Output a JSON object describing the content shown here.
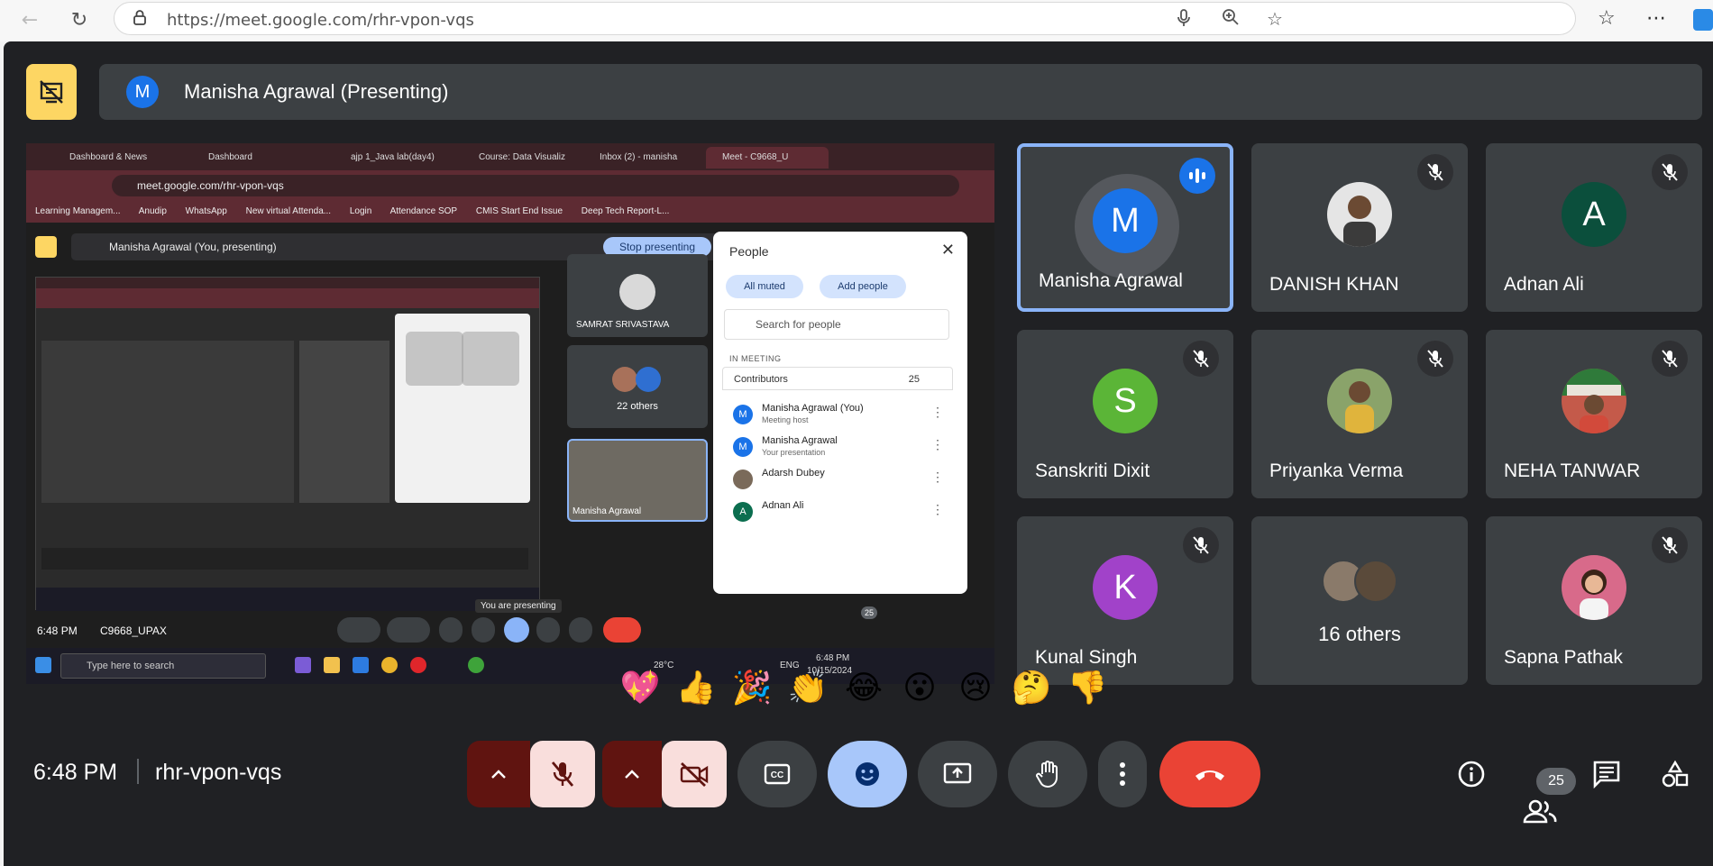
{
  "browser": {
    "url": "https://meet.google.com/rhr-vpon-vqs"
  },
  "meet": {
    "presenting_banner": "Manisha Agrawal (Presenting)",
    "presenter_initial": "M",
    "meeting_time": "6:48 PM",
    "meeting_code": "rhr-vpon-vqs",
    "participant_count": "25"
  },
  "shared_screen": {
    "tabs": [
      "Dashboard & News",
      "Dashboard",
      "ajp 1_Java lab(day4)",
      "Course: Data Visualiz",
      "Inbox (2) - manisha",
      "Meet - C9668_U"
    ],
    "url": "meet.google.com/rhr-vpon-vqs",
    "bookmarks": [
      "Learning Managem...",
      "Anudip",
      "WhatsApp",
      "New virtual Attenda...",
      "Login",
      "Attendance SOP",
      "CMIS Start End Issue",
      "Deep Tech Report-L..."
    ],
    "banner": "Manisha Agrawal (You, presenting)",
    "stop_button": "Stop presenting",
    "tile_samrat": "SAMRAT SRIVASTAVA",
    "tile_others": "22 others",
    "tile_manisha": "Manisha Agrawal",
    "you_are_presenting": "You are presenting",
    "time_code": "6:48 PM",
    "meeting_name": "C9668_UPAX",
    "count_badge": "25",
    "people": {
      "title": "People",
      "all_muted": "All muted",
      "add_people": "Add people",
      "search_placeholder": "Search for people",
      "in_meeting": "IN MEETING",
      "contributors": "Contributors",
      "contributors_count": "25",
      "rows": [
        {
          "initial": "M",
          "name": "Manisha Agrawal (You)",
          "sub": "Meeting host"
        },
        {
          "initial": "M",
          "name": "Manisha Agrawal",
          "sub": "Your presentation"
        },
        {
          "initial": "",
          "name": "Adarsh Dubey",
          "sub": ""
        },
        {
          "initial": "A",
          "name": "Adnan Ali",
          "sub": ""
        }
      ]
    },
    "taskbar": {
      "search": "Type here to search",
      "temp": "28°C",
      "lang": "ENG",
      "time": "6:48 PM",
      "date": "10/15/2024"
    }
  },
  "participants": [
    {
      "name": "Manisha Agrawal",
      "initial": "M",
      "color": "#1a73e8"
    },
    {
      "name": "DANISH KHAN",
      "initial": "",
      "color": "#d9d9d9"
    },
    {
      "name": "Adnan Ali",
      "initial": "A",
      "color": "#0b6e4f"
    },
    {
      "name": "Sanskriti Dixit",
      "initial": "S",
      "color": "#5bb537"
    },
    {
      "name": "Priyanka Verma",
      "initial": "",
      "color": "#c9a46a"
    },
    {
      "name": "NEHA TANWAR",
      "initial": "",
      "color": "#b34a4a"
    },
    {
      "name": "Kunal Singh",
      "initial": "K",
      "color": "#a142c9"
    },
    {
      "name": "16 others",
      "initial": "",
      "color": "#777"
    },
    {
      "name": "Sapna Pathak",
      "initial": "",
      "color": "#d86a8a"
    }
  ],
  "reactions": [
    "💖",
    "👍",
    "🎉",
    "👏",
    "😂",
    "😮",
    "😢",
    "🤔",
    "👎"
  ],
  "colors": {
    "background": "#202124",
    "tile": "#3c4043",
    "accent_blue": "#8ab4f8",
    "end_call": "#ea4335",
    "muted_bg": "#f9dedc",
    "muted_split": "#601410"
  }
}
